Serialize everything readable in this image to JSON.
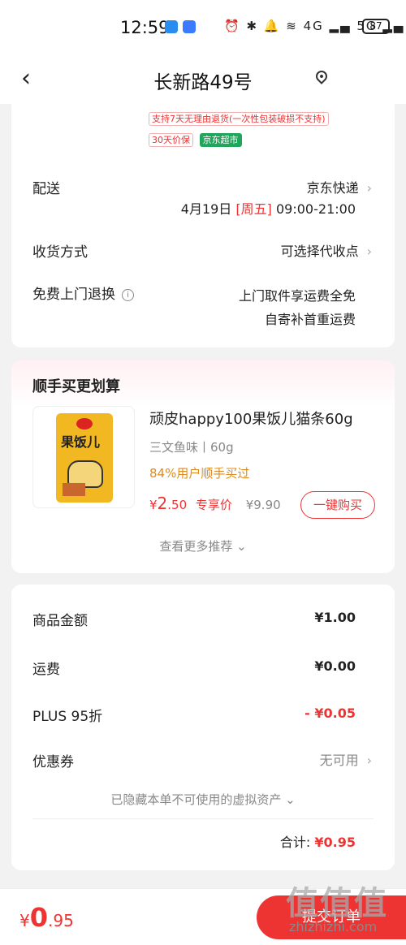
{
  "status_bar": {
    "time": "12:59",
    "battery": "87",
    "icons_text": "⏰ ✱ 🔔 ≋ 4G ▂▄ 5G ▂▄"
  },
  "header": {
    "address": "长新路49号"
  },
  "delivery": {
    "tag_return": "支持7天无理由退货(一次性包装破损不支持)",
    "tag_price": "30天价保",
    "tag_store": "京东超市",
    "shipping_label": "配送",
    "shipping_value": "京东快递",
    "delivery_date": "4月19日",
    "delivery_weekday": "[周五]",
    "delivery_time": "09:00-21:00",
    "receive_label": "收货方式",
    "receive_value": "可选择代收点",
    "return_label": "免费上门退换",
    "return_line1": "上门取件享运费全免",
    "return_line2": "自寄补首重运费"
  },
  "recommend": {
    "title": "顺手买更划算",
    "product_name": "顽皮happy100果饭儿猫条60g",
    "product_spec": "三文鱼味丨60g",
    "product_buy_note": "84%用户顺手买过",
    "price_symbol": "¥",
    "price_int": "2",
    "price_dec": ".50",
    "price_tag": "专享价",
    "old_price": "¥9.90",
    "buy_button": "一键购买",
    "more": "查看更多推荐 ⌄",
    "image_label": "果饭儿"
  },
  "summary": {
    "goods_label": "商品金额",
    "goods_value": "¥1.00",
    "freight_label": "运费",
    "freight_value": "¥0.00",
    "plus_label": "PLUS 95折",
    "plus_value": "- ¥0.05",
    "coupon_label": "优惠券",
    "coupon_value": "无可用",
    "hidden_assets": "已隐藏本单不可使用的虚拟资产 ⌄",
    "total_label": "合计:",
    "total_value": "¥0.95"
  },
  "bottom_bar": {
    "currency": "¥",
    "amount_int": "0",
    "amount_dec": ".95",
    "submit_label": "提交订单"
  },
  "watermark": {
    "top": "值值值",
    "bottom": "zhizhizhi.com"
  }
}
